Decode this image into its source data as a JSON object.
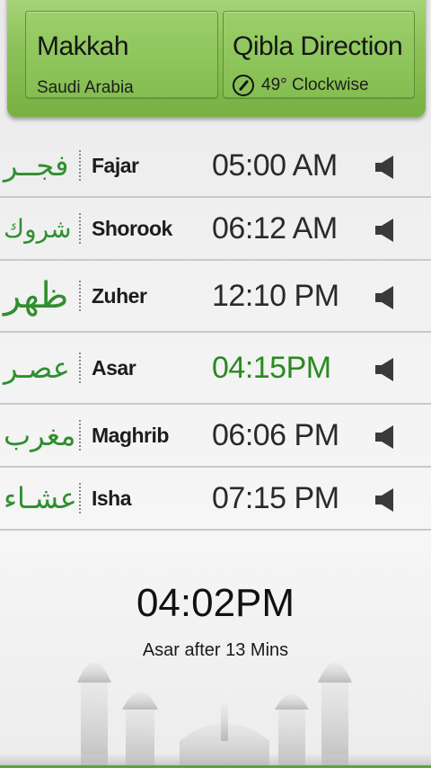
{
  "location": {
    "city": "Makkah",
    "country": "Saudi Arabia"
  },
  "qibla": {
    "title": "Qibla Direction",
    "direction": "49° Clockwise",
    "icon": "compass-icon"
  },
  "prayers": [
    {
      "arabic": "فجــر",
      "name": "Fajar",
      "time": "05:00 AM",
      "active": false
    },
    {
      "arabic": "شروك",
      "name": "Shorook",
      "time": "06:12 AM",
      "active": false
    },
    {
      "arabic": "ظهر",
      "name": "Zuher",
      "time": "12:10 PM",
      "active": false
    },
    {
      "arabic": "عصـر",
      "name": "Asar",
      "time": "04:15PM",
      "active": true
    },
    {
      "arabic": "مغرب",
      "name": "Maghrib",
      "time": "06:06 PM",
      "active": false
    },
    {
      "arabic": "عشـاء",
      "name": "Isha",
      "time": "07:15 PM",
      "active": false
    }
  ],
  "current_time": "04:02PM",
  "next_prayer_text": "Asar after 13 Mins",
  "colors": {
    "accent_green": "#2a8a1f",
    "panel_green": "#8cc158"
  }
}
